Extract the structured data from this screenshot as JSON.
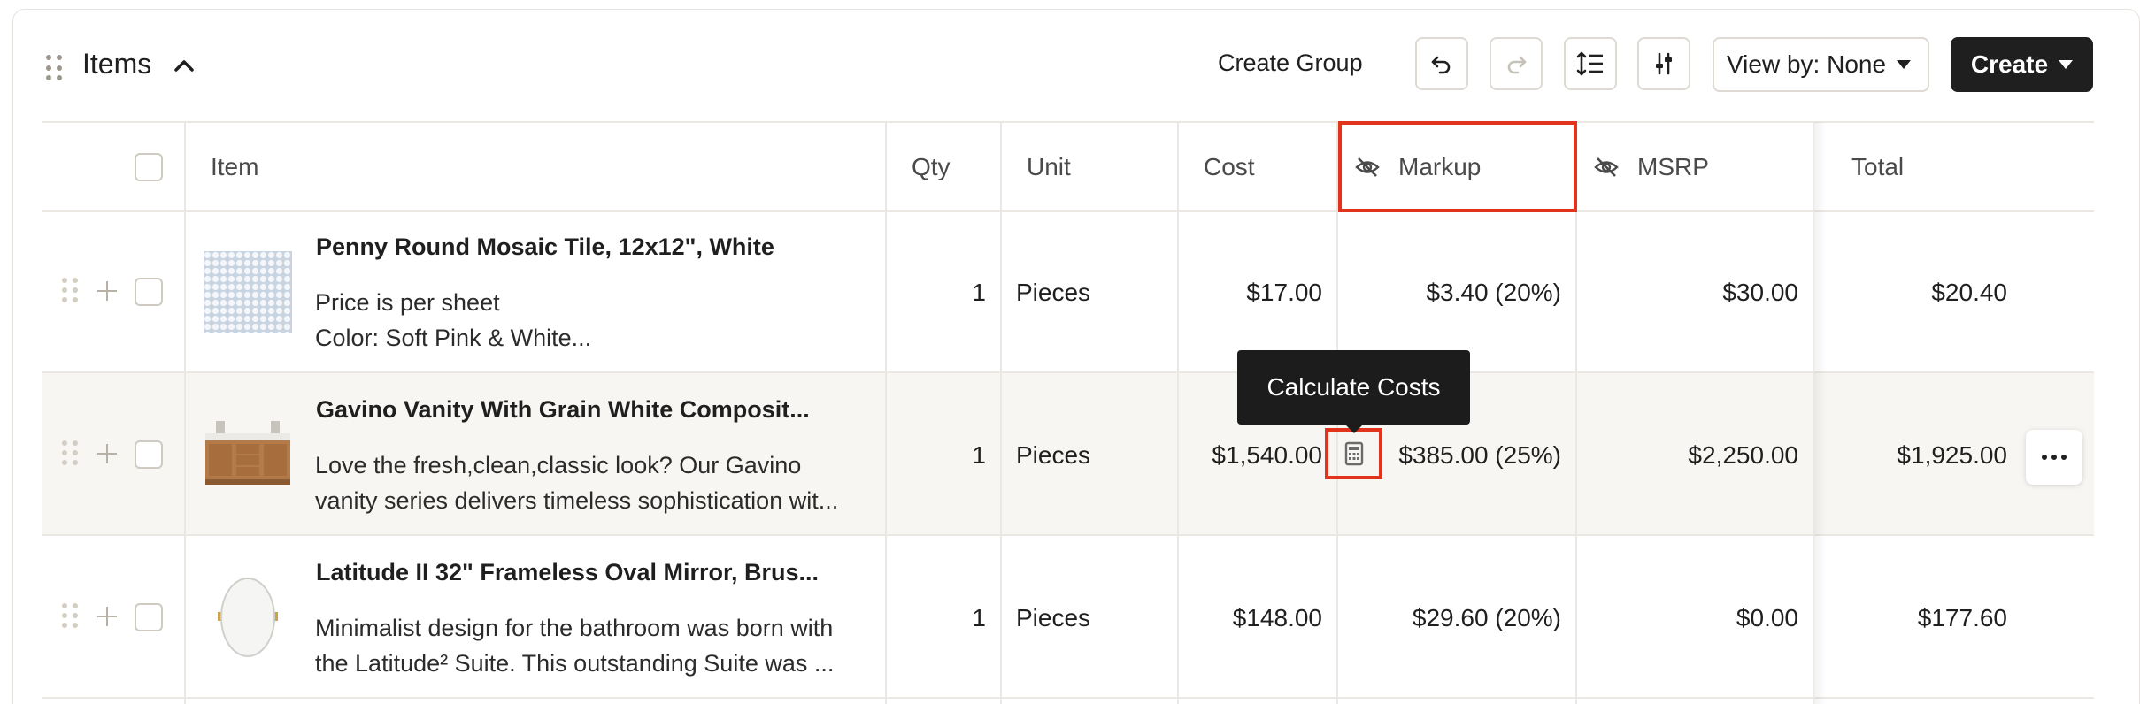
{
  "header": {
    "title": "Items",
    "create_group_label": "Create Group",
    "view_by_label": "View by: None",
    "create_label": "Create"
  },
  "table": {
    "columns": {
      "item": "Item",
      "qty": "Qty",
      "unit": "Unit",
      "cost": "Cost",
      "markup": "Markup",
      "msrp": "MSRP",
      "total": "Total"
    },
    "rows": [
      {
        "title": "Penny Round Mosaic Tile, 12x12\", White",
        "desc1": "Price is per sheet",
        "desc2": "Color: Soft Pink & White...",
        "qty": "1",
        "unit": "Pieces",
        "cost": "$17.00",
        "markup": "$3.40 (20%)",
        "msrp": "$30.00",
        "total": "$20.40"
      },
      {
        "title": "Gavino Vanity With Grain White Composit...",
        "desc1": "Love the fresh,clean,classic look? Our Gavino",
        "desc2": "vanity series delivers timeless sophistication wit...",
        "qty": "1",
        "unit": "Pieces",
        "cost": "$1,540.00",
        "markup": "$385.00 (25%)",
        "msrp": "$2,250.00",
        "total": "$1,925.00"
      },
      {
        "title": "Latitude II 32\" Frameless Oval Mirror, Brus...",
        "desc1": "Minimalist design for the bathroom was born with",
        "desc2": "the Latitude² Suite. This outstanding Suite was ...",
        "qty": "1",
        "unit": "Pieces",
        "cost": "$148.00",
        "markup": "$29.60 (20%)",
        "msrp": "$0.00",
        "total": "$177.60"
      }
    ]
  },
  "tooltip": "Calculate Costs",
  "colors": {
    "highlight": "#e2341d",
    "hover_row": "#f7f6f3",
    "primary": "#1f1f1f"
  }
}
